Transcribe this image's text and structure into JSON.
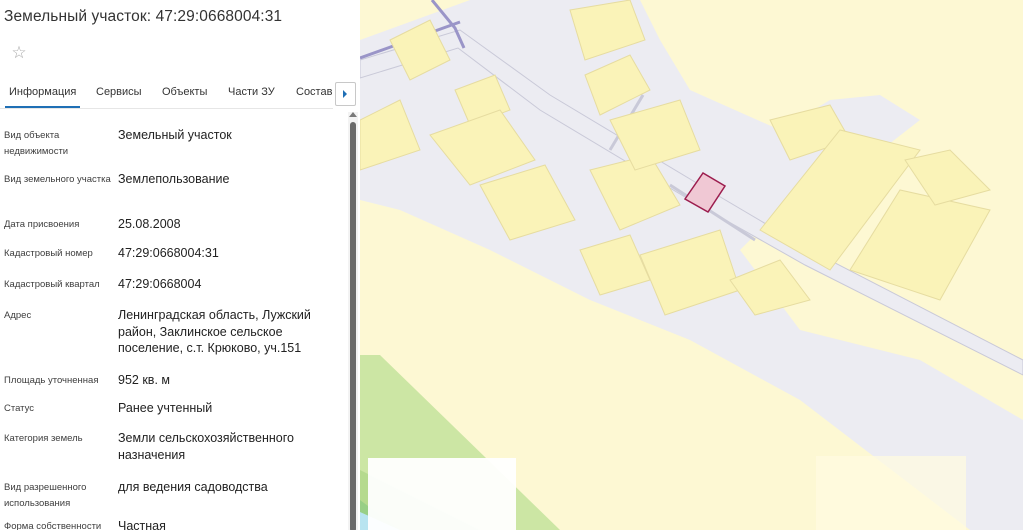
{
  "header": {
    "title": "Земельный участок: 47:29:0668004:31",
    "favorite_icon": "star-outline-icon",
    "favorite_glyph": "☆"
  },
  "tabs": [
    {
      "label": "Информация",
      "active": true
    },
    {
      "label": "Сервисы",
      "active": false
    },
    {
      "label": "Объекты",
      "active": false
    },
    {
      "label": "Части ЗУ",
      "active": false
    },
    {
      "label": "Состав",
      "active": false
    }
  ],
  "tabs_next_icon": "chevron-right-icon",
  "properties": [
    {
      "label": "Вид объекта недвижимости",
      "value": "Земельный участок"
    },
    {
      "label": "Вид земельного участка",
      "value": "Землепользование"
    },
    {
      "label": "Дата присвоения",
      "value": "25.08.2008"
    },
    {
      "label": "Кадастровый номер",
      "value": "47:29:0668004:31"
    },
    {
      "label": "Кадастровый квартал",
      "value": "47:29:0668004"
    },
    {
      "label": "Адрес",
      "value": "Ленинградская область, Лужский район, Заклинское сельское поселение, с.т. Крюково, уч.151"
    },
    {
      "label": "Площадь уточненная",
      "value": "952 кв. м"
    },
    {
      "label": "Статус",
      "value": "Ранее учтенный"
    },
    {
      "label": "Категория земель",
      "value": "Земли сельскохозяйственного назначения"
    },
    {
      "label": "Вид разрешенного использования",
      "value": "для ведения садоводства"
    },
    {
      "label": "Форма собственности",
      "value": "Частная"
    }
  ],
  "map": {
    "colors": {
      "background": "#fdf8d3",
      "plot_fill": "#faf3b8",
      "plot_line": "#e6dca0",
      "road": "#ececf2",
      "road_edge": "#c9c9d8",
      "boundary": "#9a95c8",
      "forest_light": "#cce6a4",
      "forest_mid": "#b5da8e",
      "forest_dark": "#98cf86",
      "water": "#b8e4f0",
      "selected_fill": "#f0c8d4",
      "selected_stroke": "#9c1d4e"
    }
  }
}
